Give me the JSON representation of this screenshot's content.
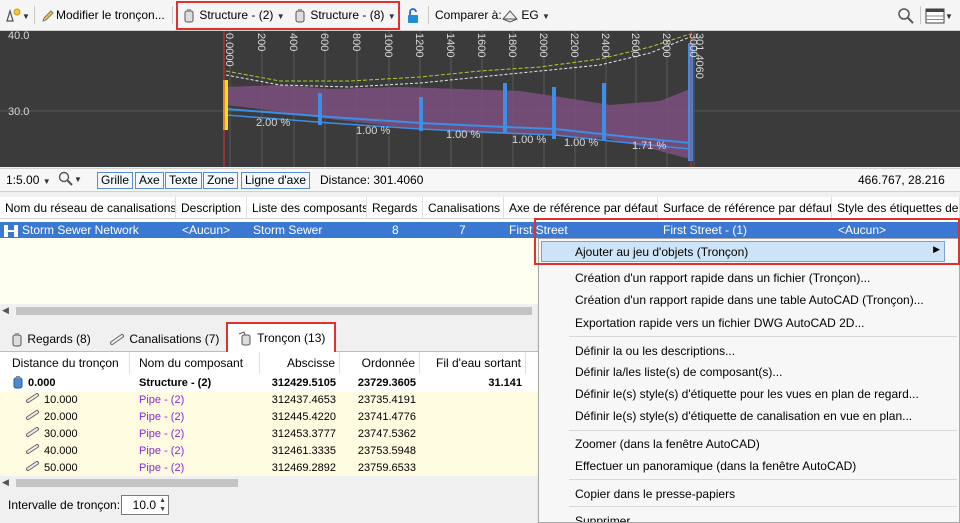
{
  "toolbar": {
    "edit_label": "Modifier le tronçon...",
    "structure_left": "Structure - (2)",
    "structure_right": "Structure - (8)",
    "compare_label": "Comparer à:",
    "compare_value": "EG"
  },
  "profile": {
    "y_labels": [
      "40.0",
      "30.0"
    ],
    "stations": [
      "0.0000",
      "200",
      "400",
      "600",
      "800",
      "1000",
      "1200",
      "1400",
      "1600",
      "1800",
      "2000",
      "2200",
      "2400",
      "2600",
      "2800",
      "3000",
      "301.4060"
    ],
    "slopes": [
      "2.00 %",
      "1.00 %",
      "1.00 %",
      "1.00 %",
      "1.00 %",
      "1.71 %"
    ]
  },
  "statusbar": {
    "scale": "1:5.00",
    "buttons": [
      "Grille",
      "Axe",
      "Texte",
      "Zone",
      "Ligne d'axe"
    ],
    "distance": "Distance: 301.4060",
    "coords": "466.767, 28.216"
  },
  "grid": {
    "headers": [
      "Nom du réseau de canalisations",
      "Description",
      "Liste des composants",
      "Regards",
      "Canalisations",
      "Axe de référence par défaut",
      "Surface de référence par défaut",
      "Style des étiquettes de"
    ],
    "row": [
      "Storm Sewer Network",
      "<Aucun>",
      "Storm Sewer",
      "8",
      "7",
      "First Street",
      "First Street - (1)",
      "<Aucun>"
    ]
  },
  "tabs": [
    "Regards (8)",
    "Canalisations (7)",
    "Tronçon (13)"
  ],
  "table": {
    "headers": [
      "Distance du tronçon",
      "Nom du composant",
      "Abscisse",
      "Ordonnée",
      "Fil d'eau sortant"
    ],
    "rows": [
      [
        "0.000",
        "Structure - (2)",
        "312429.5105",
        "23729.3605",
        "31.141"
      ],
      [
        "10.000",
        "Pipe - (2)",
        "312437.4653",
        "23735.4191",
        ""
      ],
      [
        "20.000",
        "Pipe - (2)",
        "312445.4220",
        "23741.4776",
        ""
      ],
      [
        "30.000",
        "Pipe - (2)",
        "312453.3777",
        "23747.5362",
        ""
      ],
      [
        "40.000",
        "Pipe - (2)",
        "312461.3335",
        "23753.5948",
        ""
      ],
      [
        "50.000",
        "Pipe - (2)",
        "312469.2892",
        "23759.6533",
        ""
      ]
    ]
  },
  "interval": {
    "label": "Intervalle de tronçon:",
    "value": "10.0"
  },
  "menu": {
    "items": [
      "Ajouter au jeu d'objets (Tronçon)",
      "Création d'un rapport rapide dans un fichier (Tronçon)...",
      "Création d'un rapport rapide dans une table AutoCAD (Tronçon)...",
      "Exportation rapide vers un fichier DWG AutoCAD 2D...",
      "Définir la ou les descriptions...",
      "Définir la/les liste(s) de composant(s)...",
      "Définir le(s) style(s) d'étiquette pour les vues en plan de regard...",
      "Définir le(s) style(s) d'étiquette de canalisation en vue en plan...",
      "Zoomer (dans la fenêtre AutoCAD)",
      "Effectuer un panoramique (dans la fenêtre AutoCAD)",
      "Copier dans le presse-papiers",
      "Supprimer"
    ]
  },
  "colors": {
    "selection": "#3a78d2",
    "highlight_box": "#e03030",
    "component_link": "#8a2bd0",
    "profile_bg": "#3b3b3b"
  }
}
